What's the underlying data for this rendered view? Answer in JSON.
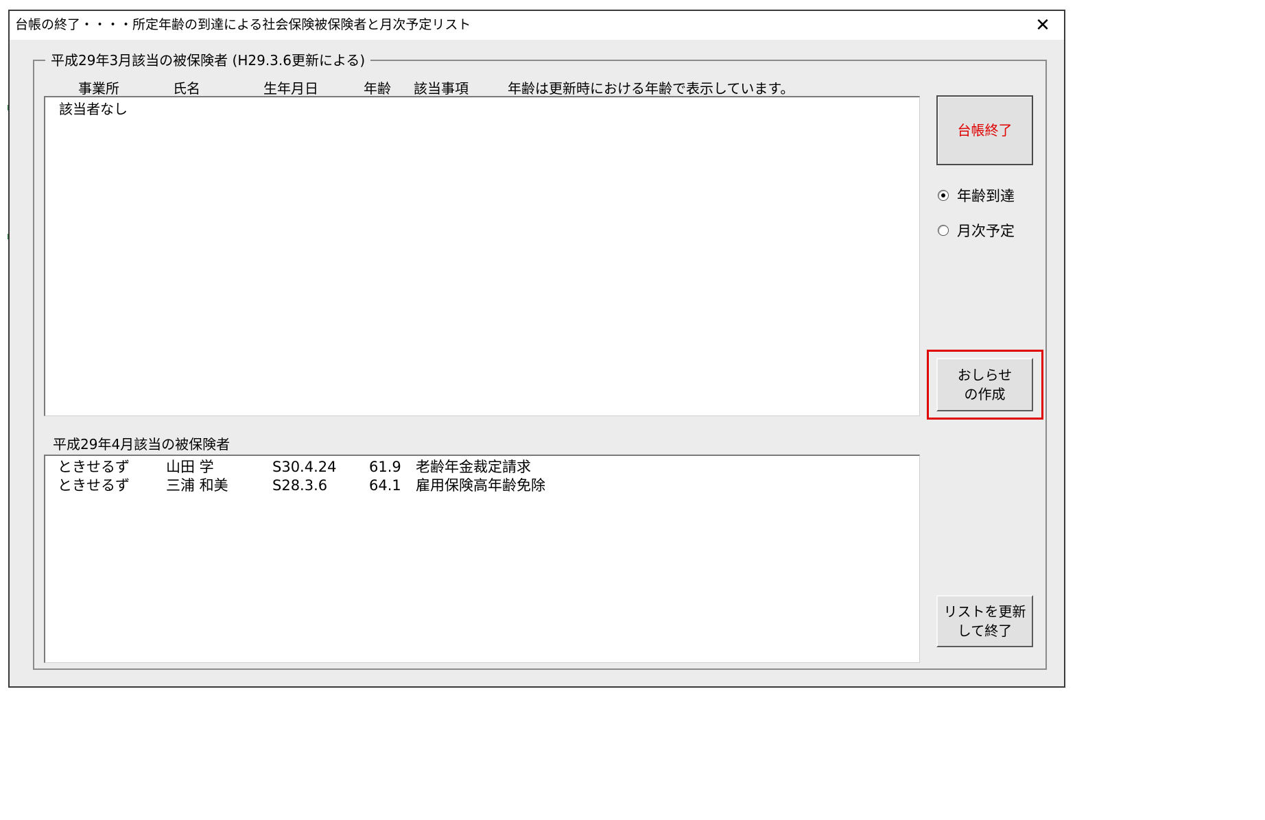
{
  "window": {
    "title": "台帳の終了・・・・所定年齢の到達による社会保険被保険者と月次予定リスト",
    "close_label": "✕"
  },
  "section": {
    "legend": "平成29年3月該当の被保険者 (H29.3.6更新による)",
    "headers": [
      "事業所",
      "氏名",
      "生年月日",
      "年齢",
      "該当事項",
      "年齢は更新時における年齢で表示しています。"
    ]
  },
  "list1": {
    "empty_text": "該当者なし"
  },
  "list2": {
    "title": "平成29年4月該当の被保険者",
    "rows": [
      [
        "ときせるず",
        "山田 学",
        "S30.4.24",
        "61.9",
        "老齢年金裁定請求"
      ],
      [
        "ときせるず",
        "三浦 和美",
        "S28.3.6",
        "64.1",
        "雇用保険高年齢免除"
      ]
    ]
  },
  "buttons": {
    "end_ledger": "台帳終了",
    "make_notice": "おしらせ\nの作成",
    "update_and_exit": "リストを更新\nして終了"
  },
  "options": {
    "age_reached": "年齢到達",
    "monthly_plan": "月次予定",
    "selected": "age_reached"
  },
  "colors": {
    "accent_red": "#e00000",
    "window_bg": "#ececec"
  }
}
